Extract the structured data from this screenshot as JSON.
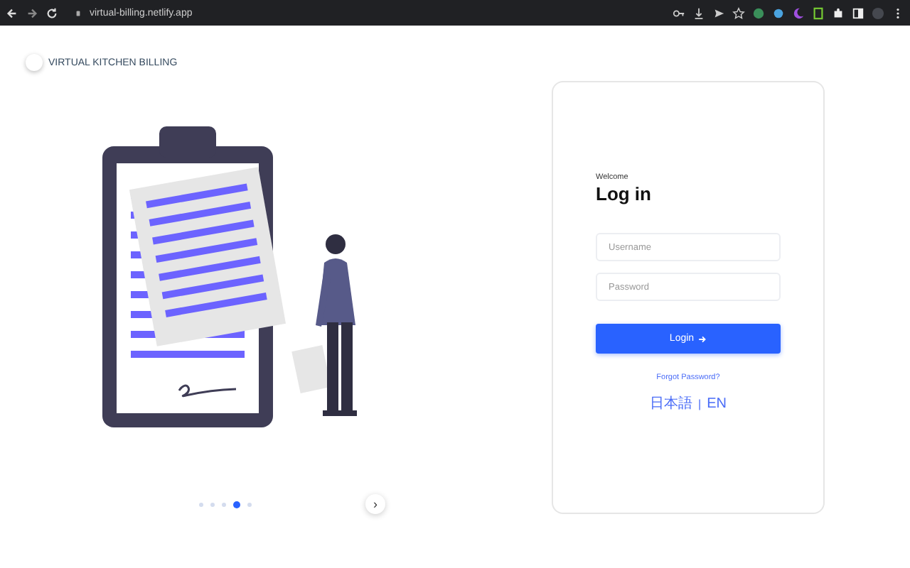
{
  "browser": {
    "url": "virtual-billing.netlify.app"
  },
  "brand": {
    "name": "VIRTUAL KITCHEN BILLING"
  },
  "carousel": {
    "dots": [
      {
        "selected": false
      },
      {
        "selected": false
      },
      {
        "selected": false
      },
      {
        "selected": true
      },
      {
        "selected": false
      }
    ],
    "next": "›"
  },
  "login": {
    "greeting": "Welcome",
    "title": "Log in",
    "username": {
      "placeholder": "Username"
    },
    "password": {
      "placeholder": "Password"
    },
    "submit": "Login",
    "forgot": "Forgot Password?",
    "languages": [
      {
        "label": "日本語"
      },
      {
        "label": "EN"
      }
    ],
    "separator": "|"
  }
}
